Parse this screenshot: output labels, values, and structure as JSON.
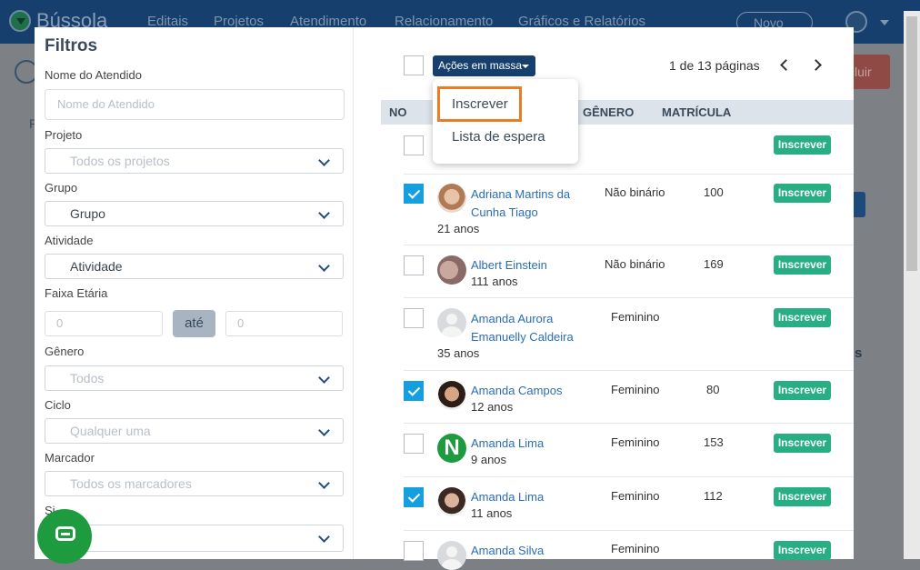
{
  "background": {
    "brand": "Bússola",
    "nav": [
      "Editais",
      "Projetos",
      "Atendimento",
      "Relacionamento",
      "Gráficos e Relatórios"
    ],
    "novo_label": "Novo",
    "excluir_label": "cluir",
    "tab_fragment": "P",
    "s_fragment": "s"
  },
  "filters": {
    "title": "Filtros",
    "nome_label": "Nome do Atendido",
    "nome_placeholder": "Nome do Atendido",
    "projeto_label": "Projeto",
    "projeto_value": "Todos os projetos",
    "grupo_label": "Grupo",
    "grupo_value": "Grupo",
    "atividade_label": "Atividade",
    "atividade_value": "Atividade",
    "faixa_label": "Faixa Etária",
    "age_from_placeholder": "0",
    "ate_label": "até",
    "age_to_placeholder": "0",
    "genero_label": "Gênero",
    "genero_value": "Todos",
    "ciclo_label": "Ciclo",
    "ciclo_value": "Qualquer uma",
    "marcador_label": "Marcador",
    "marcador_value": "Todos os marcadores",
    "situacao_label": "Si"
  },
  "list": {
    "bulk_label": "Ações em massa",
    "pages_label": "1 de 13 páginas",
    "columns": {
      "nome": "NO",
      "genero": "GÊNERO",
      "matricula": "MATRÍCULA"
    },
    "dropdown": [
      "Inscrever",
      "Lista de espera"
    ],
    "inscrever_label": "Inscrever",
    "rows": [
      {
        "name": "",
        "age": "",
        "gender": "",
        "matricula": "",
        "checked": false,
        "avatar": "none"
      },
      {
        "name": "Adriana Martins da Cunha Tiago",
        "name_l1": "Adriana Martins da",
        "name_l2": "Cunha Tiago",
        "age": "21 anos",
        "gender": "Não binário",
        "matricula": "100",
        "checked": true,
        "avatar": "photo"
      },
      {
        "name": "Albert Einstein",
        "age": "111 anos",
        "gender": "Não binário",
        "matricula": "169",
        "checked": false,
        "avatar": "photo"
      },
      {
        "name": "Amanda Aurora Emanuelly Caldeira",
        "name_l1": "Amanda Aurora",
        "name_l2": "Emanuelly Caldeira",
        "age": "35 anos",
        "gender": "Feminino",
        "matricula": "",
        "checked": false,
        "avatar": "placeholder"
      },
      {
        "name": "Amanda Campos",
        "age": "12 anos",
        "gender": "Feminino",
        "matricula": "80",
        "checked": true,
        "avatar": "photo"
      },
      {
        "name": "Amanda Lima",
        "age": "9 anos",
        "gender": "Feminino",
        "matricula": "153",
        "checked": false,
        "avatar": "letter-N",
        "avatar_letter": "N"
      },
      {
        "name": "Amanda Lima",
        "age": "11 anos",
        "gender": "Feminino",
        "matricula": "112",
        "checked": true,
        "avatar": "photo"
      },
      {
        "name": "Amanda Silva",
        "age": "",
        "gender": "Feminino",
        "matricula": "",
        "checked": false,
        "avatar": "placeholder"
      }
    ]
  }
}
